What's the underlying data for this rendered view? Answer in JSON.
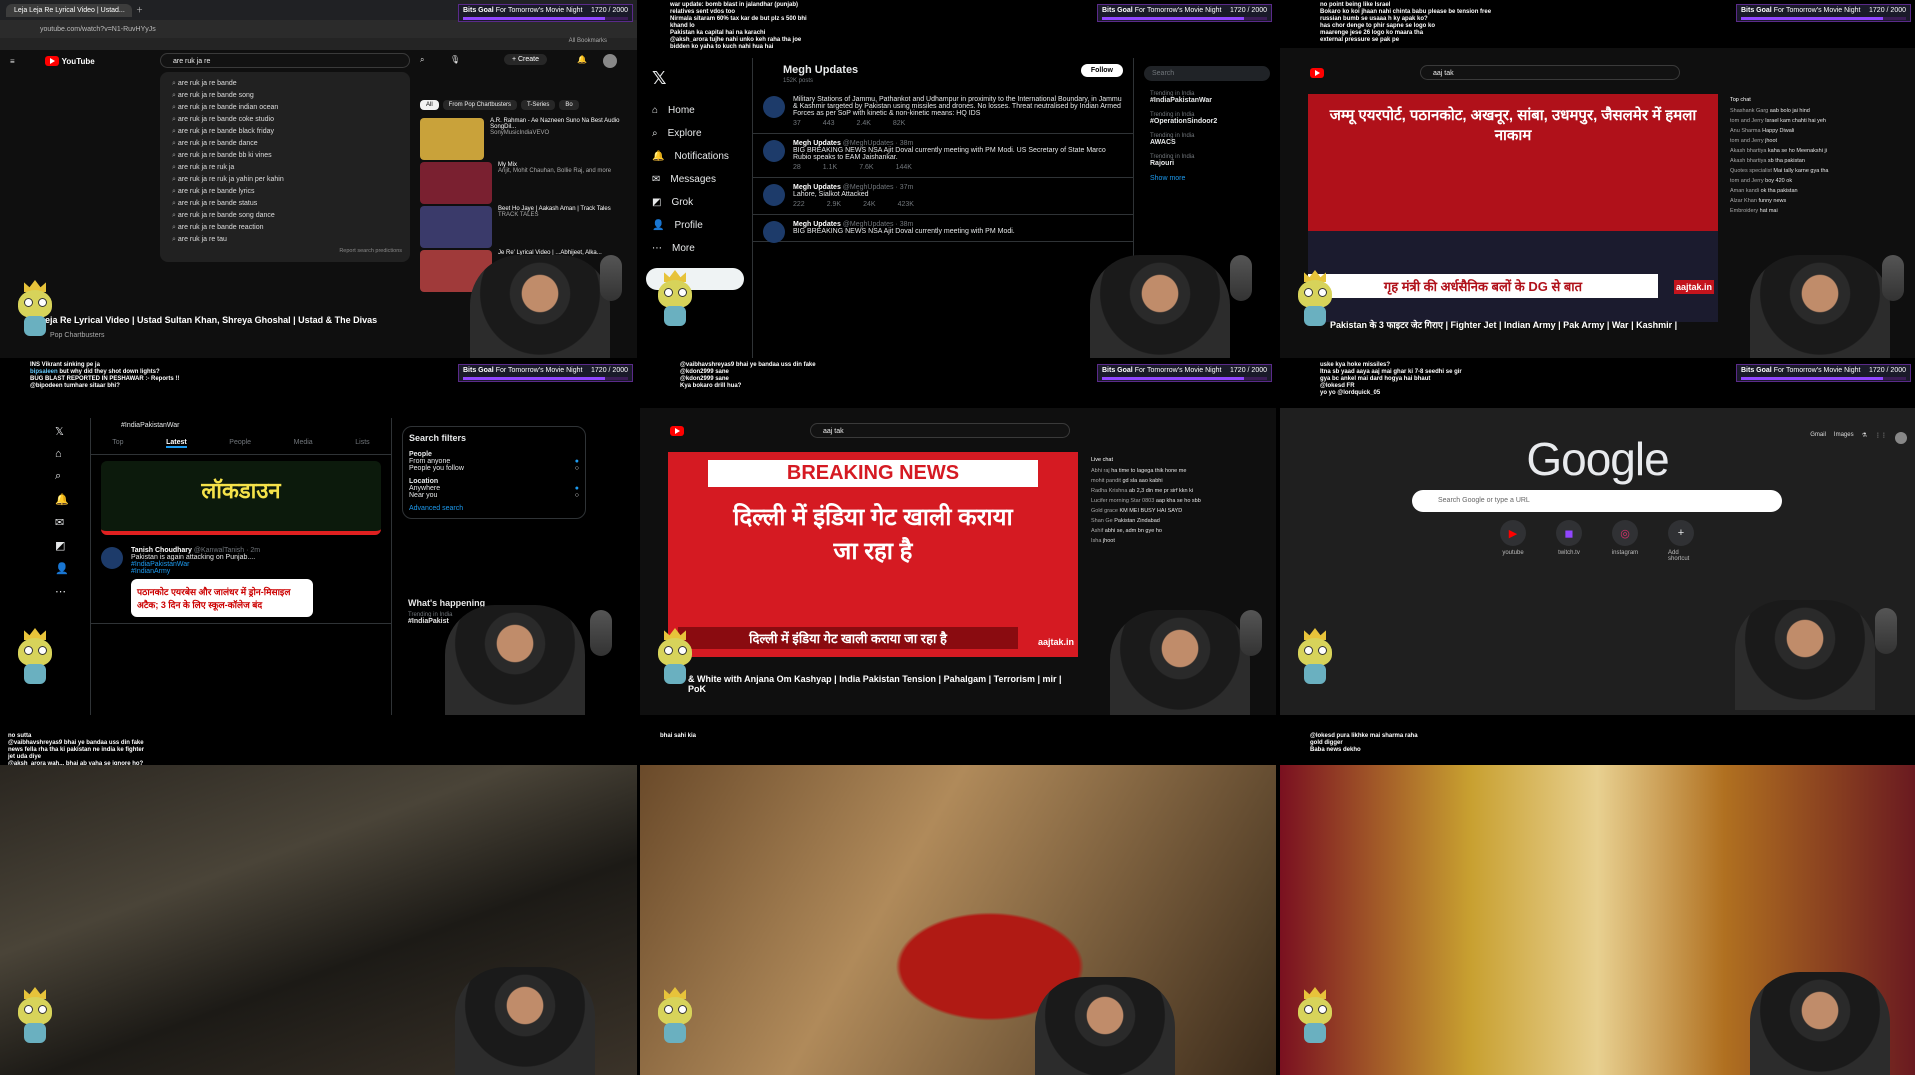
{
  "bits_goal": {
    "label": "Bits Goal",
    "text": "For Tomorrow's Movie Night",
    "count": "1720 / 2000",
    "sub": "New Bits",
    "progress": 0.86
  },
  "panel1": {
    "tabs": [
      "Leja Leja Re Lyrical Video | Ustad...",
      ""
    ],
    "url": "youtube.com/watch?v=N1-RuvHYyJs",
    "bookmarks": "All Bookmarks",
    "logo": "YouTube",
    "search_value": "are ruk ja re",
    "create": "+ Create",
    "suggestions": [
      "are ruk ja re bande",
      "are ruk ja re bande song",
      "are ruk ja re bande indian ocean",
      "are ruk ja re bande coke studio",
      "are ruk ja re bande black friday",
      "are ruk ja re bande dance",
      "are ruk ja re bande bb ki vines",
      "are ruk ja re ruk ja",
      "are ruk ja re ruk ja yahin per kahin",
      "are ruk ja re bande lyrics",
      "are ruk ja re bande status",
      "are ruk ja re bande song dance",
      "are ruk ja re bande reaction",
      "are ruk ja re tau"
    ],
    "report": "Report search predictions",
    "chips": [
      "All",
      "From Pop Chartbusters",
      "T-Series",
      "Bo"
    ],
    "recs": [
      {
        "title": "A.R. Rahman - Ae Nazneen Suno Na Best Audio SongDil...",
        "meta": "SonyMusicIndiaVEVO",
        "thumb": "#c9a23a"
      },
      {
        "title": "My Mix",
        "meta": "Arijit, Mohit Chauhan, Bollie Raj, and more",
        "thumb": "#7a2030"
      },
      {
        "title": "Beet Ho Jaye | Aakash Aman | Track Tales",
        "meta": "TRACK TALES",
        "thumb": "#3a3a6a"
      },
      {
        "title": "Je Re' Lyrical Video | ...Abhijeet, Alka...",
        "meta": "",
        "thumb": "#a03a3a"
      }
    ],
    "video_title": "eja Re Lyrical Video | Ustad Sultan Khan, Shreya Ghoshal | Ustad & The Divas",
    "channel": "Pop Chartbusters"
  },
  "panel2": {
    "chat": [
      {
        "user": "",
        "text": "war update: bomb blast in jalandhar (punjab)"
      },
      {
        "user": "",
        "text": "relatives sent vdos too"
      },
      {
        "user": "",
        "text": "Nirmala sitaram 60% tax kar de but plz s 500 bhi"
      },
      {
        "user": "",
        "text": "khand lo"
      },
      {
        "user": "",
        "text": "Pakistan ka capital hai na karachi"
      },
      {
        "user": "",
        "text": "@aksh_arora tujhe nahi unko keh raha tha joe"
      },
      {
        "user": "",
        "text": "bidden ko yaha to kuch nahi hua hai"
      }
    ],
    "nav": [
      "Home",
      "Explore",
      "Notifications",
      "Messages",
      "Grok",
      "Profile",
      "More"
    ],
    "post": "Post",
    "profile_title": "Megh Updates",
    "profile_sub": "152K posts",
    "follow": "Follow",
    "tweets": [
      {
        "name": "",
        "handle": "",
        "text": "Military Stations of Jammu, Pathankot and Udhampur in proximity to the International Boundary, in Jammu & Kashmir targeted by Pakistan using missiles and drones. No losses. Threat neutralised by Indian Armed Forces as per SoP with kinetic & non-kinetic means: HQ IDS",
        "stats": [
          "37",
          "443",
          "2.4K",
          "82K"
        ]
      },
      {
        "name": "Megh Updates",
        "handle": "@MeghUpdates · 38m",
        "text": "BIG BREAKING NEWS  NSA Ajit Doval currently meeting with PM Modi.  US Secretary of State Marco Rubio speaks to EAM Jaishankar.",
        "stats": [
          "28",
          "1.1K",
          "7.6K",
          "144K"
        ]
      },
      {
        "name": "Megh Updates",
        "handle": "@MeghUpdates · 37m",
        "text": "Lahore, Sialkot Attacked",
        "stats": [
          "222",
          "2.9K",
          "24K",
          "423K"
        ]
      },
      {
        "name": "Megh Updates",
        "handle": "@MeghUpdates · 38m",
        "text": "BIG BREAKING NEWS  NSA Ajit Doval currently meeting with PM Modi.",
        "stats": []
      }
    ],
    "search": "Search",
    "trends": [
      {
        "ctx": "Trending in India",
        "name": "#IndiaPakistanWar"
      },
      {
        "ctx": "Trending in India",
        "name": "#OperationSindoor2"
      },
      {
        "ctx": "Trending in India",
        "name": "AWACS"
      },
      {
        "ctx": "Trending in India",
        "name": "Rajouri"
      }
    ],
    "show_more": "Show more"
  },
  "panel3": {
    "chat": [
      {
        "user": "",
        "text": "no point being like Israel"
      },
      {
        "user": "",
        "text": "Bokaro ko koi jhaan nahi chinta babu please be tension free"
      },
      {
        "user": "",
        "text": "russian bumb se usaaa h ky apak ko?"
      },
      {
        "user": "",
        "text": "has chor denge to phir sapne se logo ko"
      },
      {
        "user": "",
        "text": "maarenge jese 26 logo ko maara tha"
      },
      {
        "user": "",
        "text": "external pressure se pak pe"
      }
    ],
    "search_value": "aaj tak",
    "news_headline": "जम्मू एयरपोर्ट, पठानकोट, अखनूर, सांबा, उधमपुर, जैसलमेर में हमला नाकाम",
    "news_ticker": "गृह मंत्री की अर्धसैनिक बलों के DG से बात",
    "brand": "aajtak.in",
    "video_title": "Pakistan के 3 फाइटर जेट गिराए | Fighter Jet | Indian Army | Pak Army | War | Kashmir |",
    "top_chat": "Top chat",
    "live_chat": [
      {
        "user": "Shashank Garg",
        "msg": "aab bolo jai hind"
      },
      {
        "user": "tom and Jerry",
        "msg": "Israel kam chahti hai yeh"
      },
      {
        "user": "Anu Sharma",
        "msg": "Happy Diwali"
      },
      {
        "user": "tom and Jerry",
        "msg": "jhoot"
      },
      {
        "user": "Akash bhartiya",
        "msg": "kaha se ho Meenakshi ji"
      },
      {
        "user": "Akash bhartiya",
        "msg": "sb tha pakistan"
      },
      {
        "user": "Quotes specialist",
        "msg": "Mai tally karne gya tha"
      },
      {
        "user": "tom and Jerry",
        "msg": "boy 420 ok"
      },
      {
        "user": "Aman kandi",
        "msg": "ok tha pakistan"
      },
      {
        "user": "Alzar Khan",
        "msg": "funny news"
      },
      {
        "user": "Embroidery",
        "msg": "hat mai"
      }
    ]
  },
  "panel4": {
    "chat": [
      {
        "user": "",
        "text": "INS Vikrant sinking pe ja"
      },
      {
        "user": "bipsaleen",
        "text": "but why did they shot down lights?"
      },
      {
        "user": "",
        "text": "BUG BLAST REPORTED IN PESHAWAR :- Reports !!"
      },
      {
        "user": "",
        "text": "@bipodeen tumhare sitaar bhi?"
      }
    ],
    "search_value": "#IndiaPakistanWar",
    "tabs": [
      "Top",
      "Latest",
      "People",
      "Media",
      "Lists"
    ],
    "media_text": "लॉकडाउन",
    "tweet_name": "Tanish Choudhary",
    "tweet_handle": "@KanwalTanish · 2m",
    "tweet_text": "Pakistan is again attacking on Punjab....",
    "tweet_tags": "#IndiaPakistanWar",
    "tweet_tags2": "#IndianArmy",
    "card_text": "पठानकोट एयरबेस और जालंधर में ड्रोन-मिसाइल अटैक; 3 दिन के लिए स्कूल-कॉलेज बंद",
    "filters_title": "Search filters",
    "people": "People",
    "from_anyone": "From anyone",
    "people_you_follow": "People you follow",
    "location": "Location",
    "anywhere": "Anywhere",
    "near_you": "Near you",
    "advanced": "Advanced search",
    "whats_happening": "What's happening",
    "trend_ctx": "Trending in India",
    "trend_name": "#IndiaPakist"
  },
  "panel5": {
    "chat": [
      {
        "user": "",
        "text": "@vaibhavshreyas9 bhai ye bandaa uss din fake"
      },
      {
        "user": "",
        "text": "@kdon2999 sane"
      },
      {
        "user": "",
        "text": "@kdon2999 sane"
      },
      {
        "user": "",
        "text": "Kya bokaro drill hua?"
      }
    ],
    "url": "youtube.com/watch?v=EzFC2Cz8gm8",
    "search_value": "aaj tak",
    "breaking": "BREAKING NEWS",
    "headline": "दिल्ली में इंडिया गेट खाली कराया जा रहा है",
    "ticker": "दिल्ली में इंडिया गेट खाली कराया जा रहा है",
    "brand": "aajtak.in",
    "video_title": "& White with Anjana Om Kashyap | India Pakistan Tension | Pahalgam | Terrorism | mir | PoK",
    "live_chat": "Live chat",
    "msgs": [
      {
        "user": "Abhi raj",
        "msg": "ha time to lagega thik hone me"
      },
      {
        "user": "mohit pandit",
        "msg": "gd sla aao kabhi"
      },
      {
        "user": "Radha Krishna",
        "msg": "ab 2,3 din me pr sirf kkn ki"
      },
      {
        "user": "Lucifer morning Star 0803",
        "msg": "aap kha se ho sbb"
      },
      {
        "user": "Gold grace",
        "msg": "KM MEI BUSY HAI SAYD"
      },
      {
        "user": "Shan Ge",
        "msg": "Pakistan Zindabad"
      },
      {
        "user": "Ashif",
        "msg": "abhi se, adm bn gye ho"
      },
      {
        "user": "Isha",
        "msg": "jhoot"
      }
    ]
  },
  "panel6": {
    "chat": [
      {
        "user": "",
        "text": "uske kya hoke missiles?"
      },
      {
        "user": "",
        "text": "Itna sb yaad aaya aaj mai ghar ki 7-8 seedhi se gir"
      },
      {
        "user": "",
        "text": "gya bc ankel mai dard hogya hai bhaut"
      },
      {
        "user": "",
        "text": "@lokesd FR"
      },
      {
        "user": "",
        "text": "yo yo @lordquick_05"
      }
    ],
    "top_links": [
      "Gmail",
      "Images"
    ],
    "logo": "Google",
    "search_placeholder": "Search Google or type a URL",
    "shortcuts": [
      {
        "label": "youtube",
        "glyph": "▶",
        "color": "#ff0000"
      },
      {
        "label": "twitch.tv",
        "glyph": "◼",
        "color": "#9146ff"
      },
      {
        "label": "instagram",
        "glyph": "◎",
        "color": "#e1306c"
      },
      {
        "label": "Add shortcut",
        "glyph": "+",
        "color": "#e8eaed"
      }
    ]
  },
  "panel7": {
    "chat": [
      {
        "user": "",
        "text": "no sutta"
      },
      {
        "user": "",
        "text": "@vaibhavshreyas9 bhai ye bandaa uss din fake"
      },
      {
        "user": "",
        "text": "news fella rha tha ki pakistan ne india ke fighter"
      },
      {
        "user": "",
        "text": "jet uda diye"
      },
      {
        "user": "",
        "text": "@aksh_arora wah... bhai ab yaha se ignore ho?"
      },
      {
        "user": "",
        "text": "bhai"
      }
    ]
  },
  "panel8": {
    "chat": [
      {
        "user": "",
        "text": "bhai sahi kia"
      }
    ]
  },
  "panel9": {
    "chat": [
      {
        "user": "",
        "text": "@lokesd pura likhke mai sharma raha"
      },
      {
        "user": "",
        "text": "gold digger"
      },
      {
        "user": "",
        "text": "Baba news dekho"
      }
    ]
  }
}
